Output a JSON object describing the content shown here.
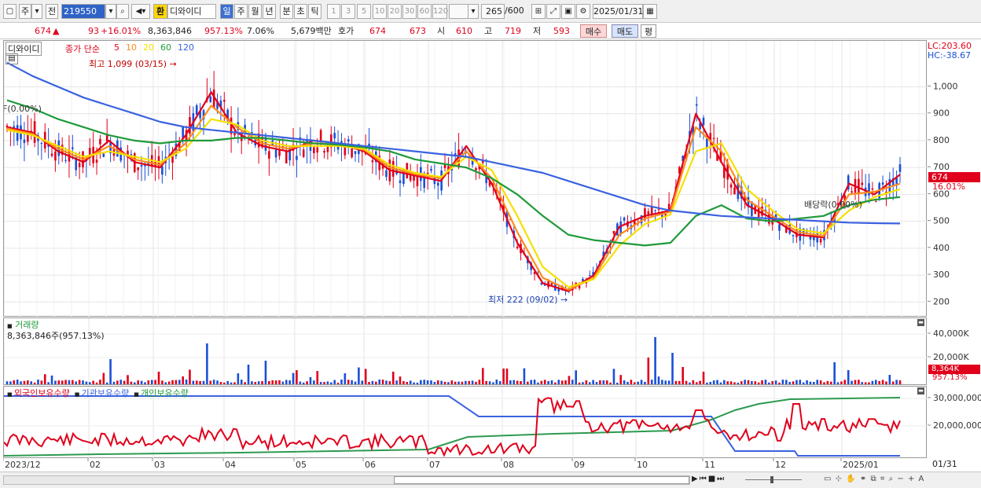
{
  "toolbar": {
    "type_selector": "주",
    "prev_label": "전",
    "code": "219550",
    "name": "디와이디",
    "hwan_label": "환",
    "periods": [
      "일",
      "주",
      "월",
      "년",
      "분",
      "초",
      "틱"
    ],
    "active_period": "일",
    "intervals": [
      "1",
      "3",
      "5",
      "10",
      "20",
      "30",
      "60",
      "120"
    ],
    "count": "265",
    "count_max": "/600",
    "date": "2025/01/31"
  },
  "quote": {
    "price": "674",
    "change_arrow": "▲",
    "change": "93",
    "change_pct": "+16.01%",
    "volume": "8,363,846",
    "volume_pct": "957.13%",
    "turnover_pct": "7.06%",
    "amount": "5,679백만",
    "hoga_label": "호가",
    "ask": "674",
    "bid": "673",
    "open_label": "시",
    "open": "610",
    "high_label": "고",
    "high": "719",
    "low_label": "저",
    "low": "593",
    "buy_label": "매수",
    "sell_label": "매도",
    "eval_label": "평"
  },
  "price_pane": {
    "name": "디와이디",
    "legend_label": "종가 단순",
    "ma_periods": [
      "5",
      "10",
      "20",
      "60",
      "120"
    ],
    "ma_colors": [
      "#e0001b",
      "#ff8c1a",
      "#f5e000",
      "#1e9a3a",
      "#3a62e0"
    ],
    "high_annotation": "최고 1,099 (03/15)",
    "low_annotation": "최저 222 (09/02)",
    "left_annotation": "F(0.00%)",
    "dividend_annotation": "배당락(0.00%)",
    "lc": "LC:203.60",
    "hc": "HC:-38.67",
    "current_price_tag": "674",
    "current_pct_tag": "16.01%",
    "y_ticks": [
      "1,000",
      "900",
      "800",
      "700",
      "600",
      "500",
      "400",
      "300",
      "200"
    ]
  },
  "volume_pane": {
    "title": "거래량",
    "value": "8,363,846주(957.13%)",
    "y_ticks": [
      "40,000K",
      "20,000K"
    ],
    "current_tag": "8,364K",
    "current_pct": "957.13%"
  },
  "holdings_pane": {
    "legend": [
      "외국인보유수량",
      "기관보유수량",
      "개인보유수량"
    ],
    "legend_colors": [
      "#e0001b",
      "#3a62e0",
      "#1e9a3a"
    ],
    "y_ticks": [
      "30,000,000",
      "20,000,000"
    ]
  },
  "x_axis": {
    "labels": [
      "2023/12",
      "02",
      "03",
      "04",
      "05",
      "06",
      "07",
      "08",
      "09",
      "10",
      "11",
      "12",
      "2025/01"
    ],
    "right_label": "01/31"
  },
  "chart_data": {
    "type": "line",
    "x_range": [
      "2023/12",
      "2025/01/31"
    ],
    "ylim": [
      160,
      1130
    ],
    "y_ticks": [
      200,
      300,
      400,
      500,
      600,
      700,
      800,
      900,
      1000
    ],
    "series": [
      {
        "name": "5",
        "values": [
          850,
          830,
          760,
          720,
          800,
          720,
          700,
          820,
          980,
          830,
          780,
          760,
          800,
          790,
          760,
          690,
          670,
          650,
          780,
          640,
          420,
          270,
          240,
          300,
          480,
          520,
          540,
          900,
          720,
          560,
          510,
          450,
          440,
          640,
          600,
          674
        ]
      },
      {
        "name": "10",
        "values": [
          845,
          825,
          770,
          730,
          780,
          730,
          710,
          790,
          930,
          850,
          790,
          770,
          790,
          785,
          765,
          700,
          675,
          660,
          760,
          660,
          460,
          290,
          245,
          290,
          450,
          510,
          535,
          850,
          760,
          580,
          520,
          460,
          445,
          600,
          610,
          640
        ]
      },
      {
        "name": "20",
        "values": [
          840,
          820,
          780,
          740,
          760,
          740,
          720,
          770,
          880,
          860,
          800,
          780,
          780,
          780,
          770,
          710,
          680,
          665,
          740,
          690,
          520,
          330,
          255,
          285,
          410,
          490,
          525,
          760,
          790,
          620,
          540,
          470,
          455,
          540,
          590,
          620
        ]
      },
      {
        "name": "60",
        "values": [
          950,
          920,
          880,
          850,
          820,
          800,
          790,
          800,
          800,
          810,
          810,
          800,
          790,
          785,
          775,
          760,
          730,
          715,
          700,
          660,
          600,
          520,
          450,
          430,
          420,
          410,
          420,
          520,
          560,
          510,
          500,
          510,
          520,
          560,
          580,
          590
        ]
      },
      {
        "name": "120",
        "values": [
          1090,
          1040,
          1000,
          960,
          930,
          900,
          870,
          850,
          840,
          830,
          820,
          810,
          800,
          790,
          780,
          770,
          760,
          750,
          740,
          720,
          700,
          680,
          650,
          620,
          590,
          560,
          540,
          530,
          520,
          515,
          510,
          505,
          500,
          495,
          493,
          492
        ]
      }
    ],
    "annotations": [
      {
        "label": "최고",
        "value": 1099,
        "date": "03/15"
      },
      {
        "label": "최저",
        "value": 222,
        "date": "09/02"
      }
    ]
  }
}
